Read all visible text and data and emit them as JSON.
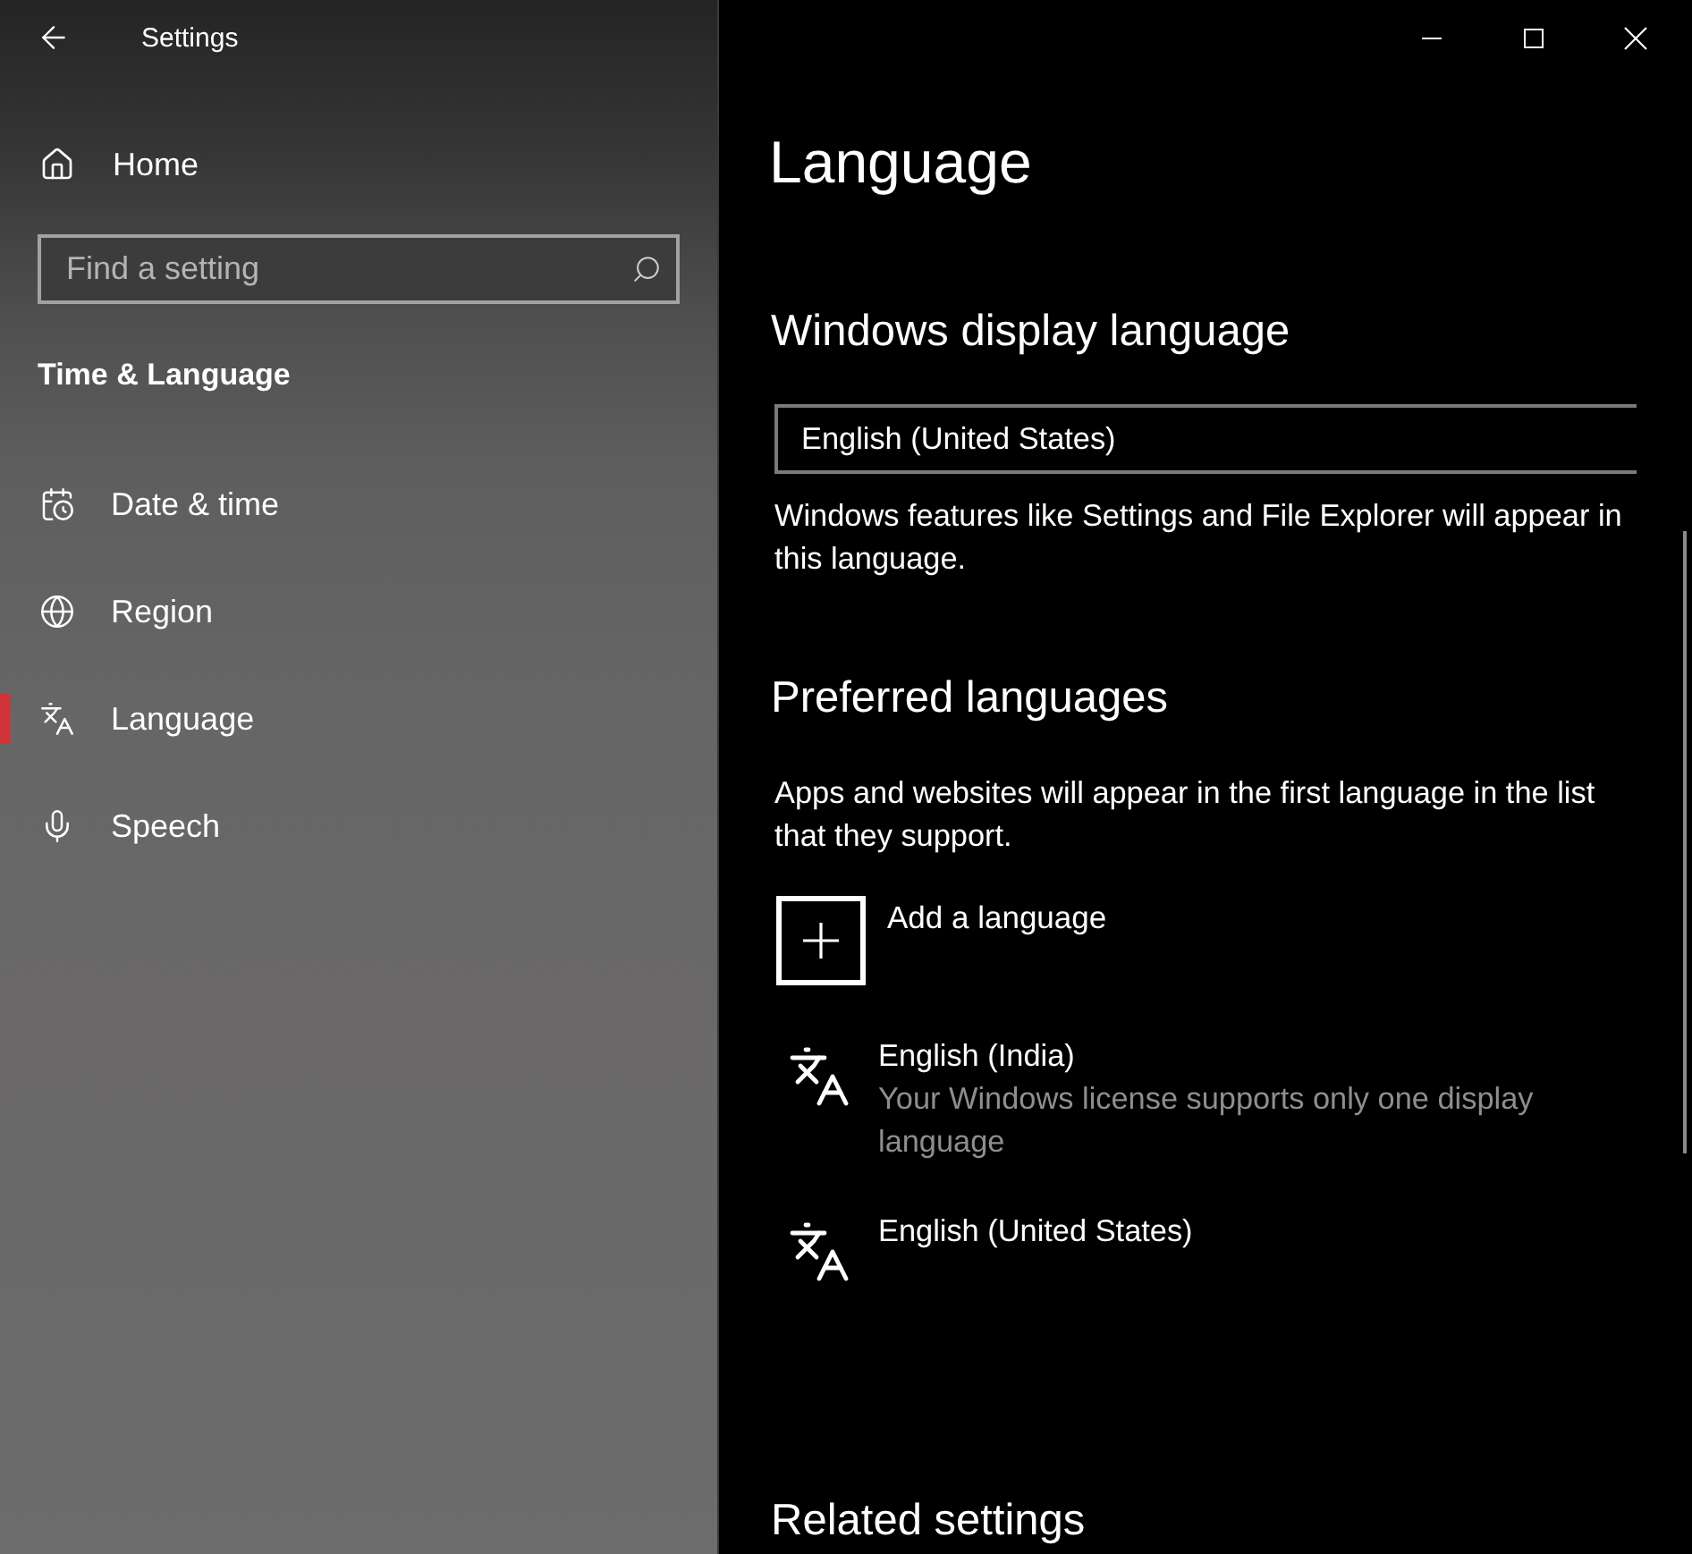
{
  "window": {
    "title": "Settings"
  },
  "sidebar": {
    "home": {
      "label": "Home"
    },
    "search": {
      "placeholder": "Find a setting"
    },
    "section_title": "Time & Language",
    "items": [
      {
        "label": "Date & time",
        "kind": "datetime",
        "selected": false
      },
      {
        "label": "Region",
        "kind": "region",
        "selected": false
      },
      {
        "label": "Language",
        "kind": "language",
        "selected": true
      },
      {
        "label": "Speech",
        "kind": "speech",
        "selected": false
      }
    ]
  },
  "page": {
    "title": "Language",
    "display_language": {
      "heading": "Windows display language",
      "value": "English (United States)",
      "description": "Windows features like Settings and File Explorer will appear in this language."
    },
    "preferred_languages": {
      "heading": "Preferred languages",
      "description": "Apps and websites will appear in the first language in the list that they support.",
      "add_button": "Add a language",
      "languages": [
        {
          "name": "English (India)",
          "note": "Your Windows license supports only one display language"
        },
        {
          "name": "English (United States)"
        }
      ]
    },
    "related_settings": {
      "heading": "Related settings"
    }
  }
}
